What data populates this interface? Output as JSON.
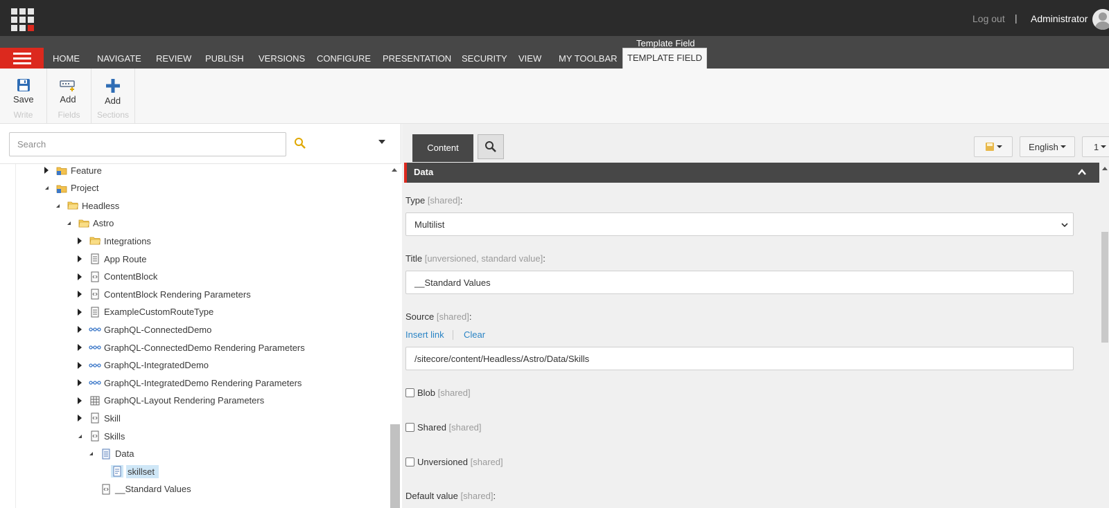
{
  "topbar": {
    "logout_label": "Log out",
    "separator": "|",
    "user_name": "Administrator"
  },
  "ribbon_tabs": {
    "items": [
      "HOME",
      "NAVIGATE",
      "REVIEW",
      "PUBLISH",
      "VERSIONS",
      "CONFIGURE",
      "PRESENTATION",
      "SECURITY",
      "VIEW",
      "MY TOOLBAR"
    ],
    "context_label": "Template Field",
    "active_tab": "TEMPLATE FIELD"
  },
  "ribbon": {
    "groups": [
      {
        "button_label": "Save",
        "group_label": "Write",
        "icon": "save-icon"
      },
      {
        "button_label": "Add",
        "group_label": "Fields",
        "icon": "add-field-icon"
      },
      {
        "button_label": "Add",
        "group_label": "Sections",
        "icon": "plus-icon"
      }
    ]
  },
  "search": {
    "placeholder": "Search"
  },
  "tree": {
    "nodes": [
      {
        "label": "Feature",
        "toggle": "collapsed",
        "icon": "module-folder-icon"
      },
      {
        "label": "Project",
        "toggle": "expanded",
        "icon": "module-folder-icon"
      },
      {
        "label": "Headless",
        "toggle": "expanded",
        "icon": "folder-icon"
      },
      {
        "label": "Astro",
        "toggle": "expanded",
        "icon": "folder-icon"
      },
      {
        "label": "Integrations",
        "toggle": "collapsed",
        "icon": "folder-icon"
      },
      {
        "label": "App Route",
        "toggle": "collapsed",
        "icon": "page-template-icon"
      },
      {
        "label": "ContentBlock",
        "toggle": "collapsed",
        "icon": "template-icon"
      },
      {
        "label": "ContentBlock Rendering Parameters",
        "toggle": "collapsed",
        "icon": "template-icon"
      },
      {
        "label": "ExampleCustomRouteType",
        "toggle": "collapsed",
        "icon": "page-template-icon"
      },
      {
        "label": "GraphQL-ConnectedDemo",
        "toggle": "collapsed",
        "icon": "connection-icon"
      },
      {
        "label": "GraphQL-ConnectedDemo Rendering Parameters",
        "toggle": "collapsed",
        "icon": "connection-icon"
      },
      {
        "label": "GraphQL-IntegratedDemo",
        "toggle": "collapsed",
        "icon": "connection-icon"
      },
      {
        "label": "GraphQL-IntegratedDemo Rendering Parameters",
        "toggle": "collapsed",
        "icon": "connection-icon"
      },
      {
        "label": "GraphQL-Layout Rendering Parameters",
        "toggle": "collapsed",
        "icon": "grid-icon"
      },
      {
        "label": "Skill",
        "toggle": "collapsed",
        "icon": "template-icon"
      },
      {
        "label": "Skills",
        "toggle": "expanded",
        "icon": "template-icon"
      },
      {
        "label": "Data",
        "toggle": "expanded",
        "icon": "section-icon"
      },
      {
        "label": "skillset",
        "toggle": "none",
        "icon": "field-icon",
        "selected": true
      },
      {
        "label": "__Standard Values",
        "toggle": "none",
        "icon": "template-icon"
      }
    ]
  },
  "editor": {
    "tabs": {
      "content_label": "Content",
      "search_icon": "search-icon"
    },
    "toolbar": {
      "language": "English",
      "version": "1"
    },
    "section_title": "Data",
    "fields": {
      "type": {
        "label": "Type",
        "meta": "[shared]",
        "value": "Multilist"
      },
      "title": {
        "label": "Title",
        "meta": "[unversioned, standard value]",
        "value": "__Standard Values"
      },
      "source": {
        "label": "Source",
        "meta": "[shared]",
        "insert_link": "Insert link",
        "clear_link": "Clear",
        "value": "/sitecore/content/Headless/Astro/Data/Skills"
      },
      "blob": {
        "label": "Blob",
        "meta": "[shared]"
      },
      "shared": {
        "label": "Shared",
        "meta": "[shared]"
      },
      "unversioned": {
        "label": "Unversioned",
        "meta": "[shared]"
      },
      "default_value": {
        "label": "Default value",
        "meta": "[shared]"
      }
    }
  },
  "colors": {
    "accent_red": "#dc291e",
    "dark_bar": "#2b2b2b",
    "tab_bar": "#474747",
    "link_blue": "#2a84c5",
    "selected_bg": "#cfe7f7"
  }
}
